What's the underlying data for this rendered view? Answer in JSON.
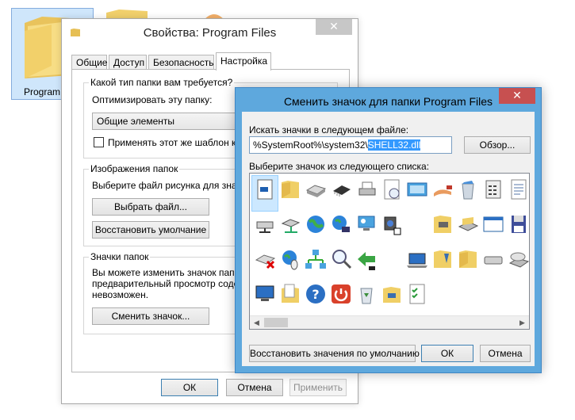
{
  "desktop": {
    "folder_label": "Program"
  },
  "props_window": {
    "title": "Свойства: Program Files",
    "close_glyph": "✕",
    "tabs": [
      {
        "label": "Общие"
      },
      {
        "label": "Доступ"
      },
      {
        "label": "Безопасность"
      },
      {
        "label": "Настройка",
        "active": true
      }
    ],
    "folder_type_group": {
      "legend": "Какой тип папки вам требуется?",
      "optimize_label": "Оптимизировать эту папку:",
      "optimize_value": "Общие элементы",
      "apply_template_label": "Применять этот же шаблон ко вс"
    },
    "folder_pictures_group": {
      "legend": "Изображения папок",
      "description": "Выберите файл рисунка для значка",
      "choose_file_button": "Выбрать файл...",
      "restore_default_button": "Восстановить умолчание"
    },
    "folder_icons_group": {
      "legend": "Значки папок",
      "description_line1": "Вы можете изменить значок папки",
      "description_line2": "предварительный просмотр содерж",
      "description_line3": "невозможен.",
      "change_icon_button": "Сменить значок..."
    },
    "ok_button": "ОК",
    "cancel_button": "Отмена",
    "apply_button": "Применить"
  },
  "icon_dialog": {
    "title": "Сменить значок для папки Program Files",
    "close_glyph": "✕",
    "search_label": "Искать значки в следующем файле:",
    "path_prefix": "%SystemRoot%\\system32\\",
    "path_selected": "SHELL32.dll",
    "browse_button": "Обзор...",
    "list_label": "Выберите значок из следующего списка:",
    "restore_button": "Восстановить значения по умолчанию",
    "ok_button": "ОК",
    "cancel_button": "Отмена",
    "scroll_left_glyph": "◀",
    "scroll_right_glyph": "▶",
    "icons": [
      "document-icon",
      "folder-icon",
      "drive-icon",
      "chip-icon",
      "printer-icon",
      "clock-document-icon",
      "window-icon",
      "hand-share-icon",
      "recycle-bin-full-icon",
      "calculator-icon",
      "document-list-icon",
      "network-drive-icon",
      "network-server-icon",
      "globe-icon",
      "globe-network-icon",
      "desktop-settings-icon",
      "speaker-shortcut-icon",
      "blank-icon",
      "printer-folder-icon",
      "scanner-icon",
      "window-app-icon",
      "floppy-icon",
      "drive-error-icon",
      "globe-mouse-icon",
      "network-icon",
      "magnifier-icon",
      "back-arrow-icon",
      "blank-icon",
      "laptop-icon",
      "folder-apps-icon",
      "folder-icon",
      "drive-slim-icon",
      "cd-drive-icon",
      "computer-icon",
      "folder-document-icon",
      "help-icon",
      "power-icon",
      "recycle-bin-icon",
      "folder-network-icon",
      "checklist-icon"
    ]
  }
}
